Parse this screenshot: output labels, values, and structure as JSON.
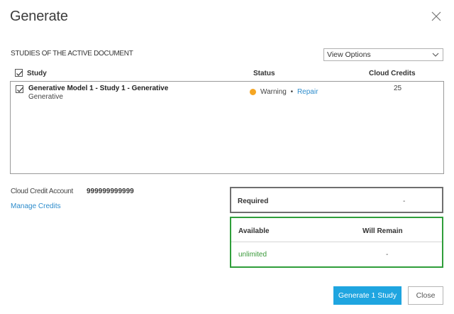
{
  "dialog": {
    "title": "Generate",
    "close_icon": "close-icon"
  },
  "studies": {
    "heading": "STUDIES OF THE ACTIVE DOCUMENT",
    "view_options": {
      "selected": "View Options",
      "icon": "chevron-down-icon"
    },
    "columns": {
      "study": "Study",
      "status": "Status",
      "credits": "Cloud Credits"
    },
    "header_checked": true,
    "rows": [
      {
        "checked": true,
        "name": "Generative Model 1 - Study 1 - Generative",
        "type": "Generative",
        "status": "Warning",
        "separator": "•",
        "action": "Repair",
        "credits": "25",
        "status_color": "#f5a623"
      }
    ]
  },
  "account": {
    "label": "Cloud Credit Account",
    "number": "999999999999",
    "manage_link": "Manage Credits"
  },
  "required": {
    "label": "Required",
    "value": "-"
  },
  "available": {
    "label": "Available",
    "remain_label": "Will Remain",
    "value": "unlimited",
    "remain_value": "-",
    "accent": "#2f9e3a"
  },
  "buttons": {
    "generate": "Generate 1 Study",
    "close": "Close",
    "primary_color": "#1fa5e0"
  }
}
